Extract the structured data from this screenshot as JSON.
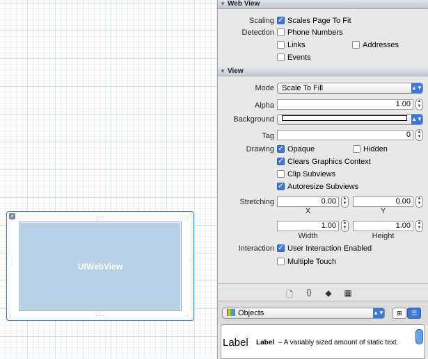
{
  "canvas": {
    "webview_label": "UIWebView",
    "close_icon": "close-icon"
  },
  "web_view": {
    "header": "Web View",
    "scaling_label": "Scaling",
    "scales_page_to_fit": {
      "label": "Scales Page To Fit",
      "checked": true
    },
    "detection_label": "Detection",
    "phone_numbers": {
      "label": "Phone Numbers",
      "checked": false
    },
    "links": {
      "label": "Links",
      "checked": false
    },
    "addresses": {
      "label": "Addresses",
      "checked": false
    },
    "events": {
      "label": "Events",
      "checked": false
    }
  },
  "view": {
    "header": "View",
    "mode_label": "Mode",
    "mode_value": "Scale To Fill",
    "alpha_label": "Alpha",
    "alpha_value": "1.00",
    "background_label": "Background",
    "tag_label": "Tag",
    "tag_value": "0",
    "drawing_label": "Drawing",
    "opaque": {
      "label": "Opaque",
      "checked": true
    },
    "hidden": {
      "label": "Hidden",
      "checked": false
    },
    "clears_graphics_context": {
      "label": "Clears Graphics Context",
      "checked": true
    },
    "clip_subviews": {
      "label": "Clip Subviews",
      "checked": false
    },
    "autoresize_subviews": {
      "label": "Autoresize Subviews",
      "checked": true
    },
    "stretching_label": "Stretching",
    "x_value": "0.00",
    "x_label": "X",
    "y_value": "0.00",
    "y_label": "Y",
    "width_value": "1.00",
    "width_label": "Width",
    "height_value": "1.00",
    "height_label": "Height",
    "interaction_label": "Interaction",
    "user_interaction_enabled": {
      "label": "User Interaction Enabled",
      "checked": true
    },
    "multiple_touch": {
      "label": "Multiple Touch",
      "checked": false
    }
  },
  "toolbar": {
    "icons": [
      "document-icon",
      "braces-icon",
      "cube-icon",
      "film-icon"
    ]
  },
  "library": {
    "objects_select": "Objects",
    "item_title": "Label",
    "item_name": "Label",
    "item_desc": "– A variably sized amount of static text."
  }
}
